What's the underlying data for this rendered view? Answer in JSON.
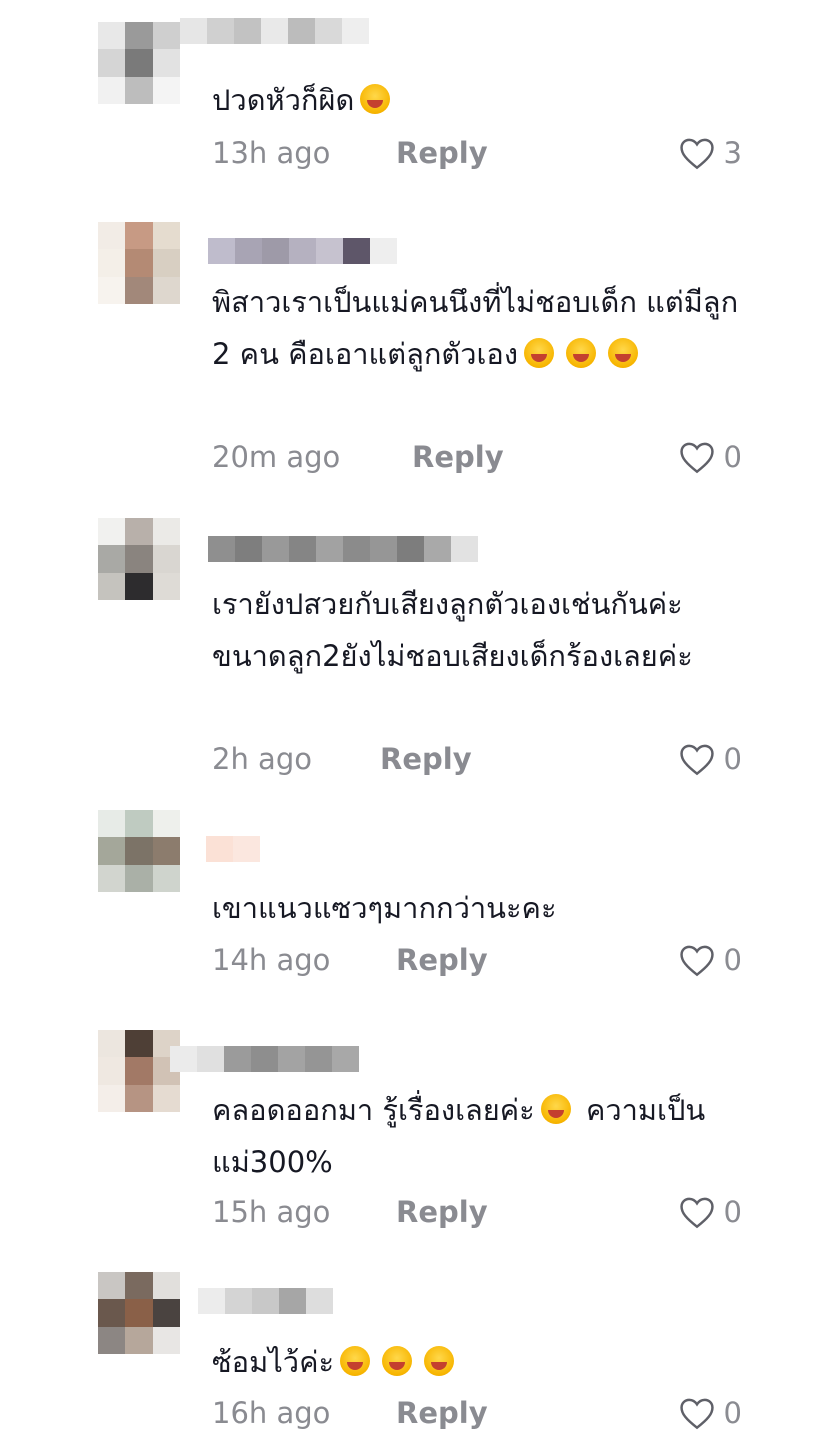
{
  "comments": [
    {
      "text": "ปวดหัวก็ผิด",
      "emojis": [
        "laughing-tears"
      ],
      "time": "13h ago",
      "reply": "Reply",
      "likes": "3"
    },
    {
      "text": "พิสาวเราเป็นแม่คนนึงที่ไม่ชอบเด็ก แต่มีลูก 2 คน คือเอาแต่ลูกตัวเอง",
      "emojis": [
        "grinning-squint",
        "grinning-squint",
        "grinning-squint"
      ],
      "time": "20m ago",
      "reply": "Reply",
      "likes": "0"
    },
    {
      "text": "เรายังปสวยกับเสียงลูกตัวเองเช่นกันค่ะขนาดลูก2ยังไม่ชอบเสียงเด็กร้องเลยค่ะ",
      "emojis": [],
      "time": "2h ago",
      "reply": "Reply",
      "likes": "0"
    },
    {
      "text": "เขาแนวแซวๆมากกว่านะคะ",
      "emojis": [],
      "time": "14h ago",
      "reply": "Reply",
      "likes": "0"
    },
    {
      "text": "คลอดออกมา รู้เรื่องเลยค่ะ",
      "text_after_emoji": "ความเป็นแม่300%",
      "emojis": [
        "beaming-grin"
      ],
      "time": "15h ago",
      "reply": "Reply",
      "likes": "0"
    },
    {
      "text": "ซ้อมไว้ค่ะ",
      "emojis": [
        "grinning",
        "smiling-eyes",
        "beaming-grin"
      ],
      "time": "16h ago",
      "reply": "Reply",
      "likes": "0"
    }
  ],
  "colors": {
    "text": "#161823",
    "meta": "#8a8b91",
    "background": "#ffffff"
  },
  "icons": {
    "like": "heart-outline-icon",
    "avatar": "pixelated-avatar",
    "username": "pixelated-username"
  }
}
